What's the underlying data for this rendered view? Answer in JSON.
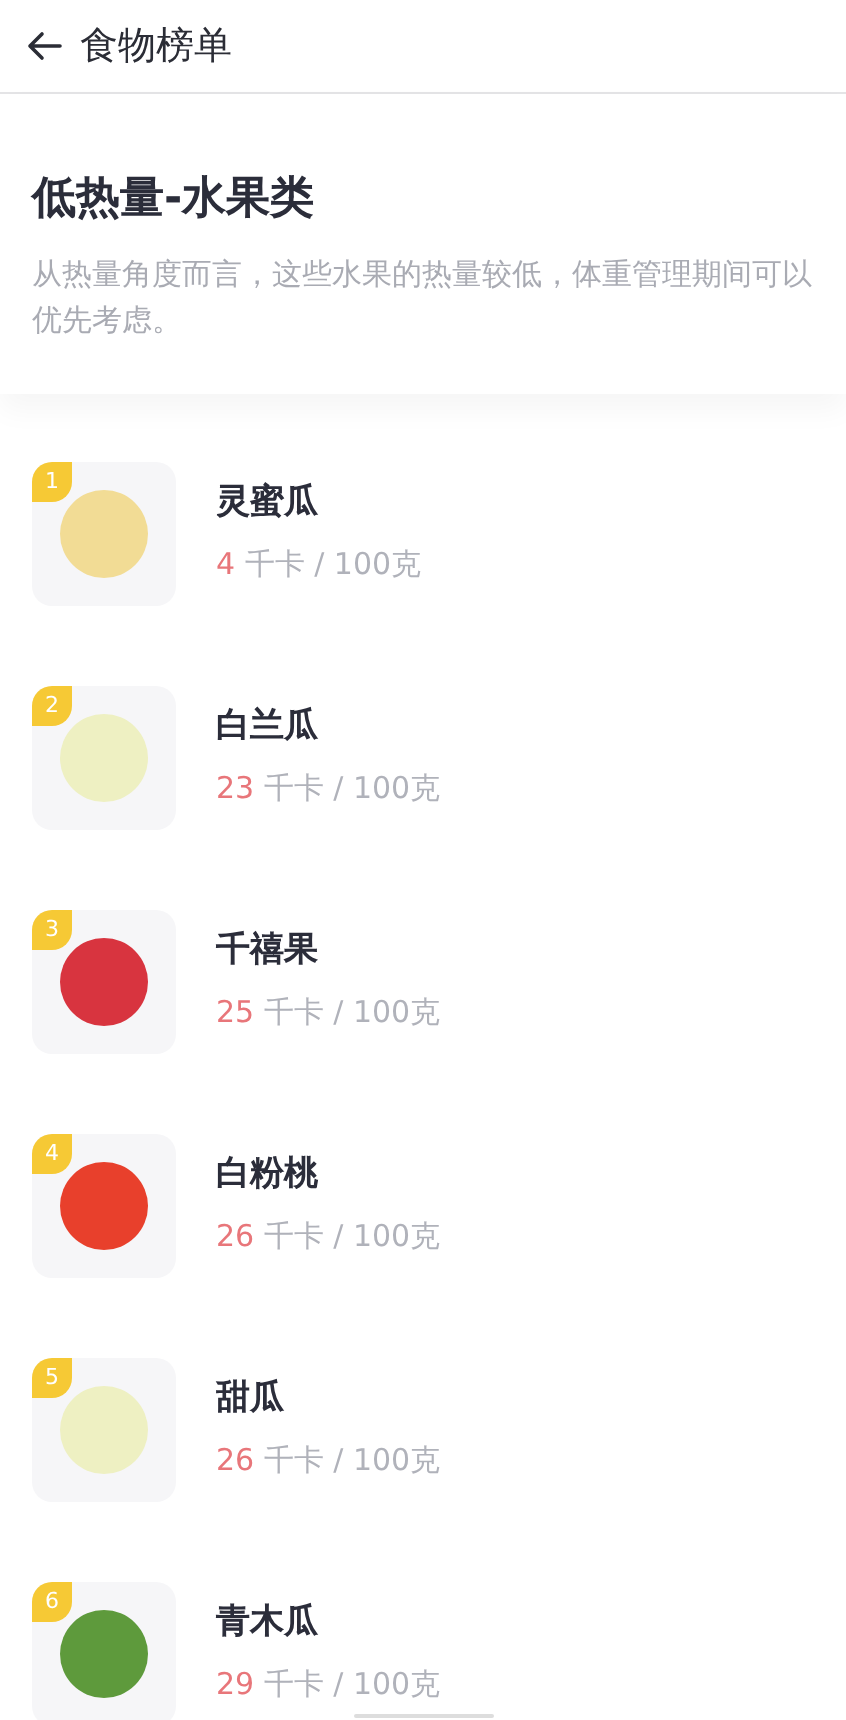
{
  "header": {
    "title": "食物榜单"
  },
  "intro": {
    "title": "低热量-水果类",
    "description": "从热量角度而言，这些水果的热量较低，体重管理期间可以优先考虑。"
  },
  "foods": [
    {
      "rank": "1",
      "name": "灵蜜瓜",
      "calories": "4",
      "unit": "千卡 / 100克"
    },
    {
      "rank": "2",
      "name": "白兰瓜",
      "calories": "23",
      "unit": "千卡 / 100克"
    },
    {
      "rank": "3",
      "name": "千禧果",
      "calories": "25",
      "unit": "千卡 / 100克"
    },
    {
      "rank": "4",
      "name": "白粉桃",
      "calories": "26",
      "unit": "千卡 / 100克"
    },
    {
      "rank": "5",
      "name": "甜瓜",
      "calories": "26",
      "unit": "千卡 / 100克"
    },
    {
      "rank": "6",
      "name": "青木瓜",
      "calories": "29",
      "unit": "千卡 / 100克"
    }
  ]
}
